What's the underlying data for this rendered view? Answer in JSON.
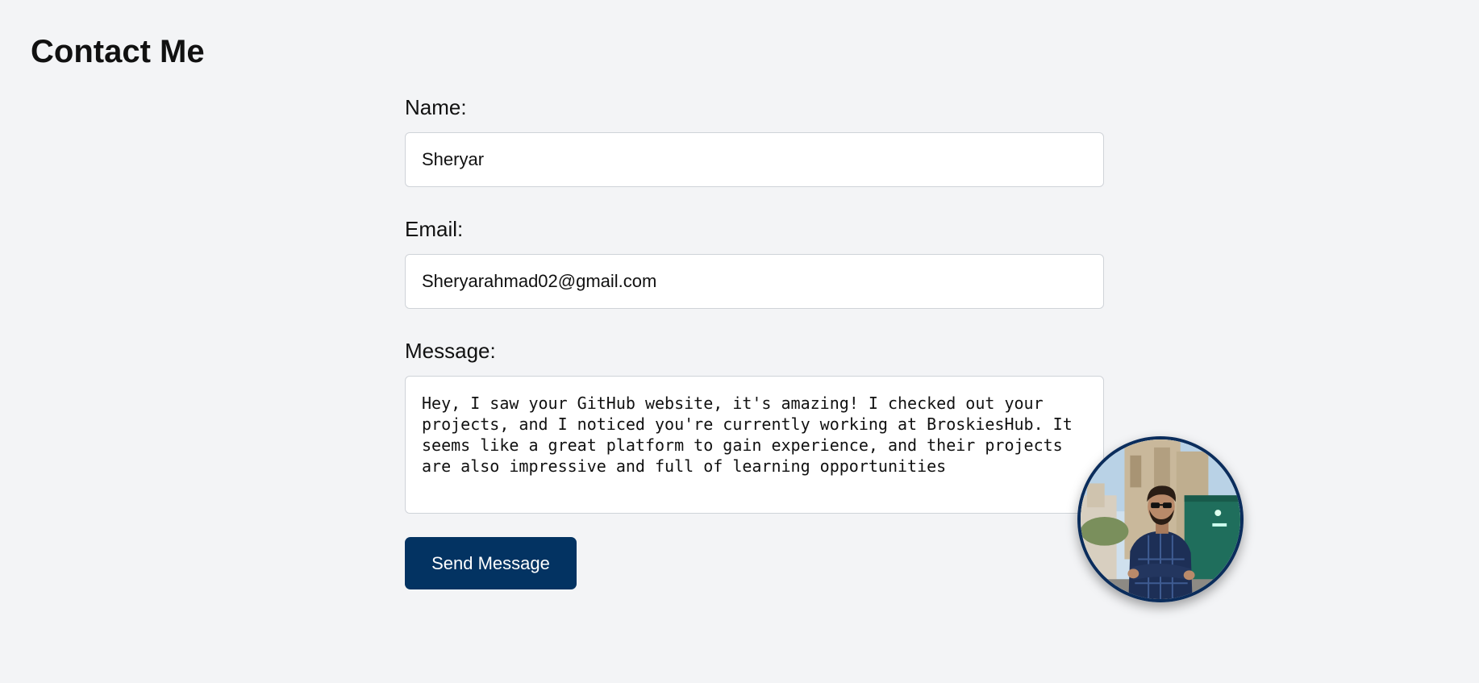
{
  "page": {
    "title": "Contact Me"
  },
  "form": {
    "name": {
      "label": "Name:",
      "value": "Sheryar"
    },
    "email": {
      "label": "Email:",
      "value": "Sheryarahmad02@gmail.com"
    },
    "message": {
      "label": "Message:",
      "value": "Hey, I saw your GitHub website, it's amazing! I checked out your projects, and I noticed you're currently working at BroskiesHub. It seems like a great platform to gain experience, and their projects are also impressive and full of learning opportunities"
    },
    "submit_label": "Send Message"
  },
  "colors": {
    "background": "#f3f4f6",
    "accent": "#033362",
    "avatar_border": "#0b2d5c"
  }
}
